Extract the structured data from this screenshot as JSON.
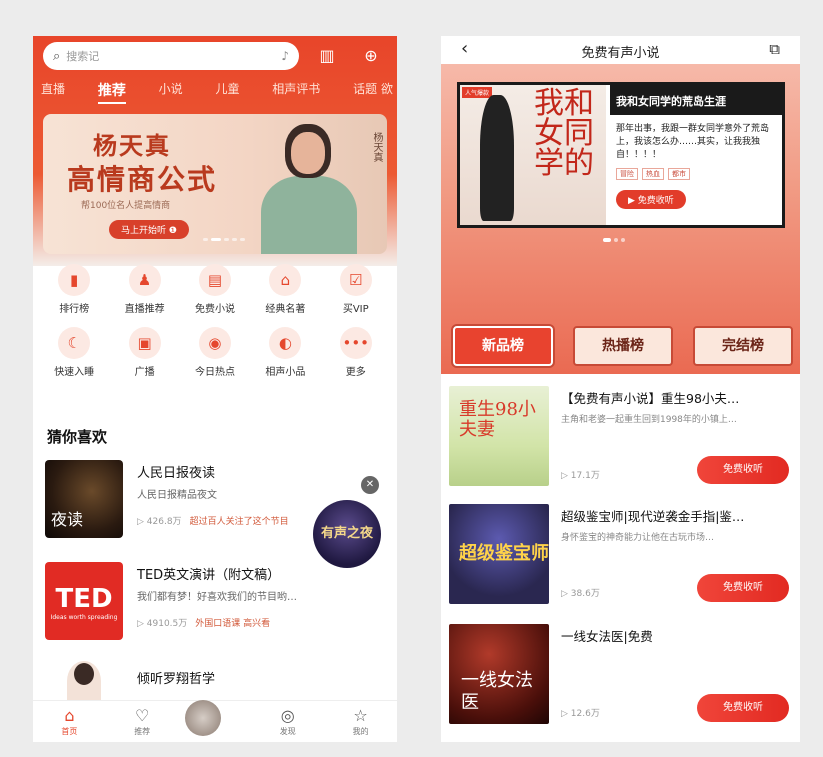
{
  "left": {
    "search": {
      "placeholder": "搜索记"
    },
    "tabs": [
      "直播",
      "推荐",
      "小说",
      "儿童",
      "相声评书",
      "话题 欲"
    ],
    "banner": {
      "name": "杨天真",
      "title": "高情商公式",
      "subtitle": "帮100位名人提高情商",
      "button": "马上开始听 ❶",
      "side_text": "杨天真"
    },
    "grid": [
      {
        "label": "排行榜",
        "icon": "chart-icon",
        "glyph": "▮"
      },
      {
        "label": "直播推荐",
        "icon": "live-icon",
        "glyph": "♟"
      },
      {
        "label": "免费小说",
        "icon": "book-icon",
        "glyph": "▤"
      },
      {
        "label": "经典名著",
        "icon": "classic-icon",
        "glyph": "⌂"
      },
      {
        "label": "买VIP",
        "icon": "vip-icon",
        "glyph": "☑"
      },
      {
        "label": "快速入睡",
        "icon": "moon-icon",
        "glyph": "☾"
      },
      {
        "label": "广播",
        "icon": "radio-icon",
        "glyph": "▣"
      },
      {
        "label": "今日热点",
        "icon": "hot-icon",
        "glyph": "◉"
      },
      {
        "label": "相声小品",
        "icon": "fan-icon",
        "glyph": "◐"
      },
      {
        "label": "更多",
        "icon": "more-icon",
        "glyph": "•••"
      }
    ],
    "section_title": "猜你喜欢",
    "recs": [
      {
        "title": "人民日报夜读",
        "desc": "人民日报精品夜文",
        "plays": "▷ 426.8万",
        "tag": "超过百人关注了这个节目",
        "cover_text": "夜读"
      },
      {
        "title": "TED英文演讲（附文稿）",
        "desc": "我们都有梦！好喜欢我们的节目哟…",
        "plays": "▷ 4910.5万",
        "tag": "外国口语课 高兴看",
        "cover_text": "TED",
        "cover_sub": "Ideas worth spreading"
      },
      {
        "title": "倾听罗翔哲学"
      }
    ],
    "float_badge": "有声之夜",
    "nav": [
      {
        "label": "首页",
        "icon": "home-icon",
        "glyph": "⌂"
      },
      {
        "label": "推荐",
        "icon": "heart-icon",
        "glyph": "♡"
      },
      {
        "label": "",
        "icon": "center-play-icon",
        "glyph": ""
      },
      {
        "label": "发现",
        "icon": "discover-icon",
        "glyph": "◎"
      },
      {
        "label": "我的",
        "icon": "profile-icon",
        "glyph": "☆"
      }
    ]
  },
  "right": {
    "title": "免费有声小说",
    "hero": {
      "book_title": "我和女同学的荒岛生涯",
      "cover_text": "我和女同学的",
      "cover_tag": "人气爆款",
      "desc": "那年出事，我跟一群女同学意外了荒岛上，我该怎么办……其实，让我我独自！！！！",
      "chips": [
        "冒险",
        "热血",
        "都市"
      ],
      "listen": "▶ 免费收听"
    },
    "rank_tabs": [
      "新品榜",
      "热播榜",
      "完结榜"
    ],
    "books": [
      {
        "title": "【免费有声小说】重生98小夫…",
        "desc": "主角和老婆一起重生回到1998年的小镇上…",
        "plays": "▷ 17.1万",
        "button": "免费收听",
        "cover_text": "重生98小夫妻"
      },
      {
        "title": "超级鉴宝师|现代逆袭金手指|鉴…",
        "desc": "身怀鉴宝的神奇能力让他在古玩市场…",
        "plays": "▷ 38.6万",
        "button": "免费收听",
        "cover_text": "超级鉴宝师"
      },
      {
        "title": "一线女法医|免费",
        "desc": "",
        "plays": "▷ 12.6万",
        "button": "免费收听",
        "cover_text": "一线女法医"
      }
    ]
  }
}
